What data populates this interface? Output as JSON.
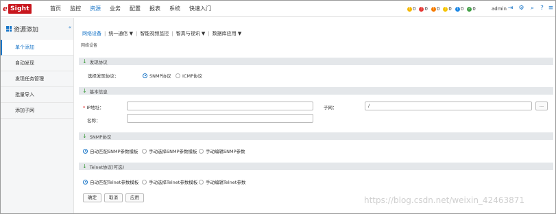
{
  "logo": {
    "e": "e",
    "box": "Sight"
  },
  "nav": [
    "首页",
    "监控",
    "资源",
    "业务",
    "配置",
    "报表",
    "系统",
    "快速入门"
  ],
  "status": [
    {
      "icon": "warning-bell-icon",
      "color": "#f5b800",
      "count": "0"
    },
    {
      "icon": "critical-icon",
      "color": "#e53935",
      "count": "0"
    },
    {
      "icon": "major-icon",
      "color": "#f57c00",
      "count": "0"
    },
    {
      "icon": "minor-icon",
      "color": "#f5c400",
      "count": "0"
    },
    {
      "icon": "info-icon",
      "color": "#1e88e5",
      "count": "0"
    },
    {
      "icon": "ok-icon",
      "color": "#43a047",
      "count": "0"
    }
  ],
  "user": "admin",
  "sidebar": {
    "title": "资源添加",
    "items": [
      "单个添加",
      "自动发现",
      "发现任务管理",
      "批量导入",
      "添加子网"
    ]
  },
  "tabs": [
    "网络设备",
    "统一通信 ▼",
    "智能视频监控",
    "智真与视讯 ▼",
    "数据库应用 ▼"
  ],
  "breadcrumb": "网络设备",
  "sections": {
    "discovery": "发现协议",
    "basic": "基本信息",
    "snmp": "SNMP协议",
    "telnet": "Telnet协议(可选)"
  },
  "discovery": {
    "label": "选择发现协议：",
    "options": [
      "SNMP协议",
      "ICMP协议"
    ]
  },
  "basic": {
    "ip_label": "IP地址：",
    "name_label": "名称：",
    "subnet_label": "子网：",
    "ip_value": "",
    "name_value": "",
    "subnet_value": "/",
    "browse": "..."
  },
  "snmp": {
    "options": [
      "自动匹配SNMP参数模板",
      "手动选择SNMP参数模板",
      "手动编辑SNMP参数"
    ]
  },
  "telnet": {
    "options": [
      "自动匹配Telnet参数模板",
      "手动选择Telnet参数模板",
      "手动编辑Telnet参数"
    ]
  },
  "buttons": {
    "ok": "确定",
    "cancel": "取消",
    "apply": "应用"
  },
  "watermark": "https://blog.csdn.net/weixin_42463871"
}
